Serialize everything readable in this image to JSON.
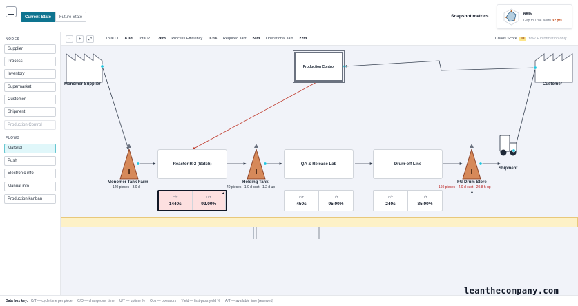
{
  "header": {
    "tabs": [
      {
        "label": "Current State",
        "active": true
      },
      {
        "label": "Future State",
        "active": false
      }
    ],
    "snapshot_label": "Snapshot metrics",
    "snapshot_percent": "68%",
    "snapshot_gap_prefix": "Gap to True North",
    "snapshot_gap_points": "32 pts"
  },
  "sidebar": {
    "nodes_title": "NODES",
    "nodes": [
      {
        "label": "Supplier",
        "state": "normal"
      },
      {
        "label": "Process",
        "state": "normal"
      },
      {
        "label": "Inventory",
        "state": "normal"
      },
      {
        "label": "Supermarket",
        "state": "normal"
      },
      {
        "label": "Customer",
        "state": "normal"
      },
      {
        "label": "Shipment",
        "state": "normal"
      },
      {
        "label": "Production Control",
        "state": "disabled"
      }
    ],
    "flows_title": "FLOWS",
    "flows": [
      {
        "label": "Material",
        "state": "selected"
      },
      {
        "label": "Push",
        "state": "normal"
      },
      {
        "label": "Electronic info",
        "state": "normal"
      },
      {
        "label": "Manual info",
        "state": "normal"
      },
      {
        "label": "Production kanban",
        "state": "normal"
      }
    ]
  },
  "toolbar": {
    "zoom_out": "−",
    "zoom_in": "+",
    "fit": "⤢",
    "metrics": {
      "total_lt_label": "Total LT",
      "total_lt_value": "8.0d",
      "total_pt_label": "Total PT",
      "total_pt_value": "36m",
      "pe_label": "Process Efficiency",
      "pe_value": "0.3%",
      "req_takt_label": "Required Takt",
      "req_takt_value": "24m",
      "op_takt_label": "Operational Takt",
      "op_takt_value": "22m"
    },
    "chaos_label": "Chaos Score",
    "chaos_value": "11",
    "chaos_note": "flow + information only"
  },
  "canvas": {
    "supplier": {
      "label": "Monomer Supplier"
    },
    "customer": {
      "label": "Customer"
    },
    "production_control": {
      "label": "Production Control"
    },
    "inventories": [
      {
        "label": "Monomer Tank Farm",
        "sub": "120 pieces · 3.0 d",
        "alert": false
      },
      {
        "label": "Holding Tank",
        "sub": "40 pieces · 1.0 d cust · 1.2 d up",
        "alert": false
      },
      {
        "label": "FG Drum Store",
        "sub": "160 pieces · 4.0 d cust · 20.8 h up",
        "alert": true
      }
    ],
    "processes": [
      {
        "label": "Reactor R-2 (Batch)",
        "ct_key": "C/T",
        "ct_val": "1440s",
        "ut_key": "U/T",
        "ut_val": "92.00%",
        "alert": true
      },
      {
        "label": "QA & Release Lab",
        "ct_key": "C/T",
        "ct_val": "450s",
        "ut_key": "U/T",
        "ut_val": "95.00%",
        "alert": false
      },
      {
        "label": "Drum-off Line",
        "ct_key": "C/T",
        "ct_val": "240s",
        "ut_key": "U/T",
        "ut_val": "85.00%",
        "alert": false
      }
    ],
    "shipment": {
      "label": "Shipment"
    },
    "warning_glyph": "▲"
  },
  "footer": {
    "key_label": "Data box key:",
    "items": [
      "C/T — cycle time per piece",
      "C/O — changeover time",
      "U/T — uptime %",
      "Ops — operators",
      "Yield — first-pass yield %",
      "A/T — available time (reserved)"
    ]
  },
  "watermark": "leanthecompany.com",
  "colors": {
    "accent": "#0e7490",
    "inventory_fill": "#d6895a",
    "timeline": "#fdf1c7",
    "alert_fill": "#fde0e0",
    "alert_text": "#b91c1c",
    "info_arrow_red": "#c0392b",
    "connector": "#22c5e0"
  }
}
